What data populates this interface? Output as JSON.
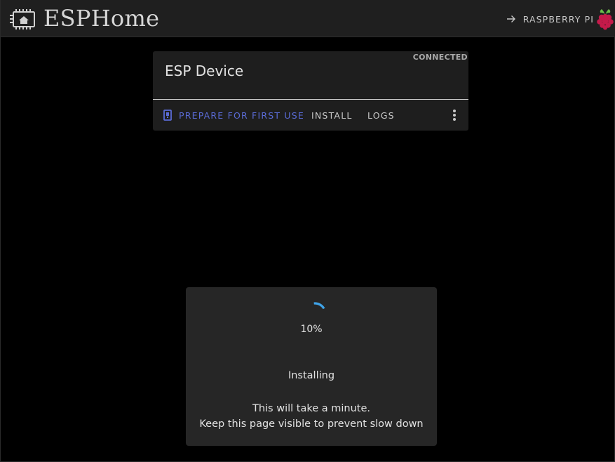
{
  "header": {
    "title": "ESPHome",
    "logo_icon": "esphome-chip-icon",
    "remote": {
      "label": "RASPBERRY PI",
      "arrow_icon": "arrow-right-icon",
      "device_icon": "raspberry-pi-icon"
    }
  },
  "device_card": {
    "name": "ESP Device",
    "status": "CONNECTED",
    "actions": {
      "prepare_label": "PREPARE FOR FIRST USE",
      "prepare_icon": "usb-device-icon",
      "install_label": "INSTALL",
      "logs_label": "LOGS",
      "menu_icon": "more-vertical-icon"
    }
  },
  "install_dialog": {
    "progress": "10%",
    "progress_value": 0.1,
    "status": "Installing",
    "message_line1": "This will take a minute.",
    "message_line2": "Keep this page visible to prevent slow down"
  },
  "colors": {
    "background": "#000000",
    "header_bg": "#1f1f1f",
    "card_bg": "#1e1e1e",
    "dialog_bg": "#262626",
    "accent": "#5a6bd6",
    "spinner": "#3fa3e8"
  }
}
